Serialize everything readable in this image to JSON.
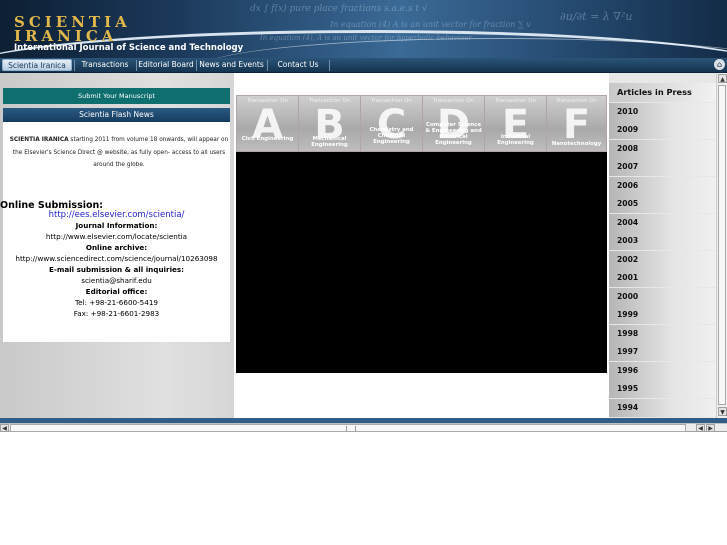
{
  "header": {
    "logo_line1": "SCIENTIA",
    "logo_line2": "IRANICA",
    "subtitle": "International Journal of Science and Technology"
  },
  "nav": {
    "items": [
      {
        "label": "Scientia Iranica",
        "active": true
      },
      {
        "label": "Transactions"
      },
      {
        "label": "Editorial Board"
      },
      {
        "label": "News and Events"
      },
      {
        "label": "Contact Us"
      }
    ],
    "corner_icon": "home-icon"
  },
  "left": {
    "submit_label": "Submit Your Manuscript",
    "flash_news_label": "Scientia Flash News",
    "announce_strong": "SCIENTIA IRANICA",
    "announce_text": " starting 2011 from volume 18 onwards, will appear on the Elsevier's Science Direct @ website, as fully open- access to all users around the globe.",
    "online_submission_label": "Online Submission:",
    "online_submission_url": "http://ees.elsevier.com/scientia/",
    "journal_info_label": "Journal Information:",
    "journal_info_url": "http://www.elsevier.com/locate/scientia",
    "archive_label": "Online archive:",
    "archive_url": "http://www.sciencedirect.com/science/journal/10263098",
    "email_label": "E-mail submission & all inquiries:",
    "email": "scientia@sharif.edu",
    "office_label": "Editorial office:",
    "tel": "Tel:  +98-21-6600-5419",
    "fax": "Fax:  +98-21-6601-2983"
  },
  "transactions": {
    "heading": "Transaction On",
    "tiles": [
      {
        "letter": "A",
        "name": "Civil Engineering"
      },
      {
        "letter": "B",
        "name": "Mechanical Engineering"
      },
      {
        "letter": "C",
        "name": "Chemistry and Chemical Engineering"
      },
      {
        "letter": "D",
        "name": "Computer Science & Engineering and Electrical Engineering"
      },
      {
        "letter": "E",
        "name": "Industrial Engineering"
      },
      {
        "letter": "F",
        "name": "Nanotechnology"
      }
    ]
  },
  "right": {
    "press_label": "Articles in Press",
    "years": [
      "2010",
      "2009",
      "2008",
      "2007",
      "2006",
      "2005",
      "2004",
      "2003",
      "2002",
      "2001",
      "2000",
      "1999",
      "1998",
      "1997",
      "1996",
      "1995",
      "1994"
    ]
  },
  "colors": {
    "logo_gold": "#e2b84a",
    "submit_teal": "#0f6e6e",
    "nav_blue": "#1f4568"
  }
}
